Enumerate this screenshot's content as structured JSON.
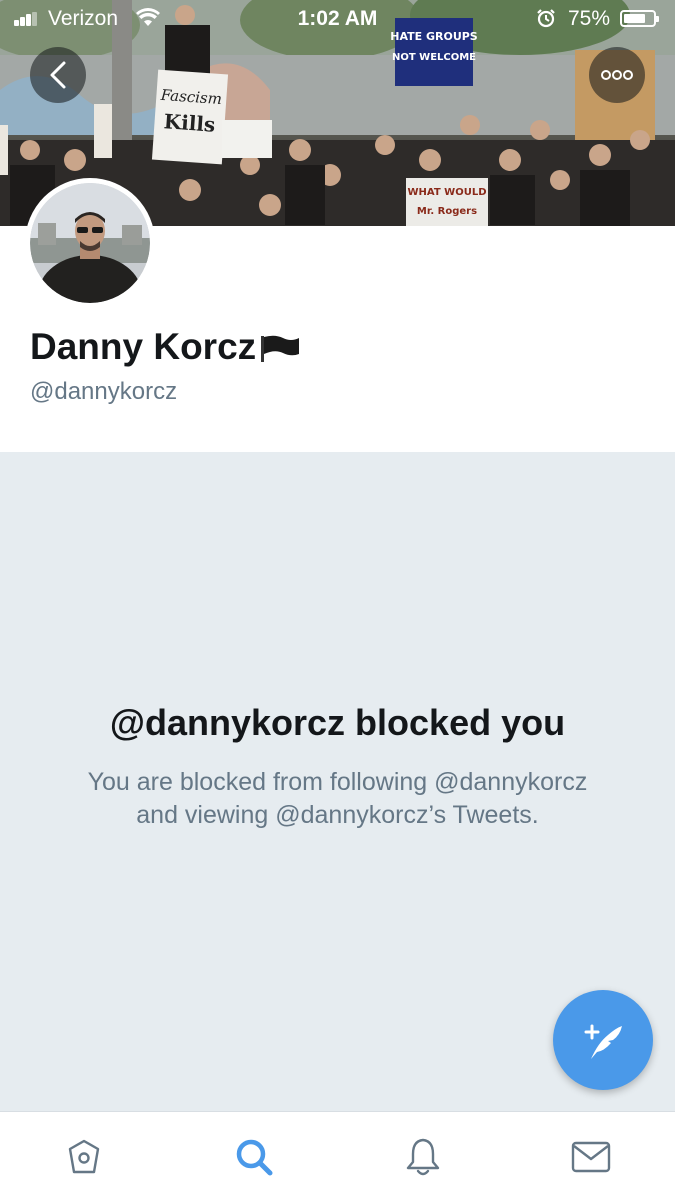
{
  "status_bar": {
    "carrier": "Verizon",
    "time": "1:02 AM",
    "battery_percent_label": "75%",
    "battery_level": 0.75
  },
  "header": {
    "back_icon": "chevron-left-icon",
    "more_icon": "more-horizontal-icon",
    "banner_signs": {
      "sign_1": "Fascism",
      "sign_2": "Kills",
      "sign_3": "HATE GROUPS",
      "sign_4": "NOT WELCOME",
      "sign_5": "WHAT WOULD",
      "sign_6": "Mr. Rogers"
    }
  },
  "profile": {
    "name": "Danny Korcz",
    "name_emoji": "black-flag-icon",
    "handle": "@dannykorcz"
  },
  "blocked": {
    "title": "@dannykorcz blocked you",
    "message": "You are blocked from following @dannykorcz and viewing @dannykorcz’s Tweets."
  },
  "compose": {
    "icon": "compose-tweet-icon",
    "color": "#4a99e9"
  },
  "tab_bar": {
    "tabs": [
      {
        "name": "home",
        "icon": "home-icon",
        "active": false
      },
      {
        "name": "search",
        "icon": "search-icon",
        "active": true
      },
      {
        "name": "notifications",
        "icon": "bell-icon",
        "active": false
      },
      {
        "name": "messages",
        "icon": "envelope-icon",
        "active": false
      }
    ],
    "active_color": "#4a99e9",
    "inactive_color": "#657786"
  }
}
